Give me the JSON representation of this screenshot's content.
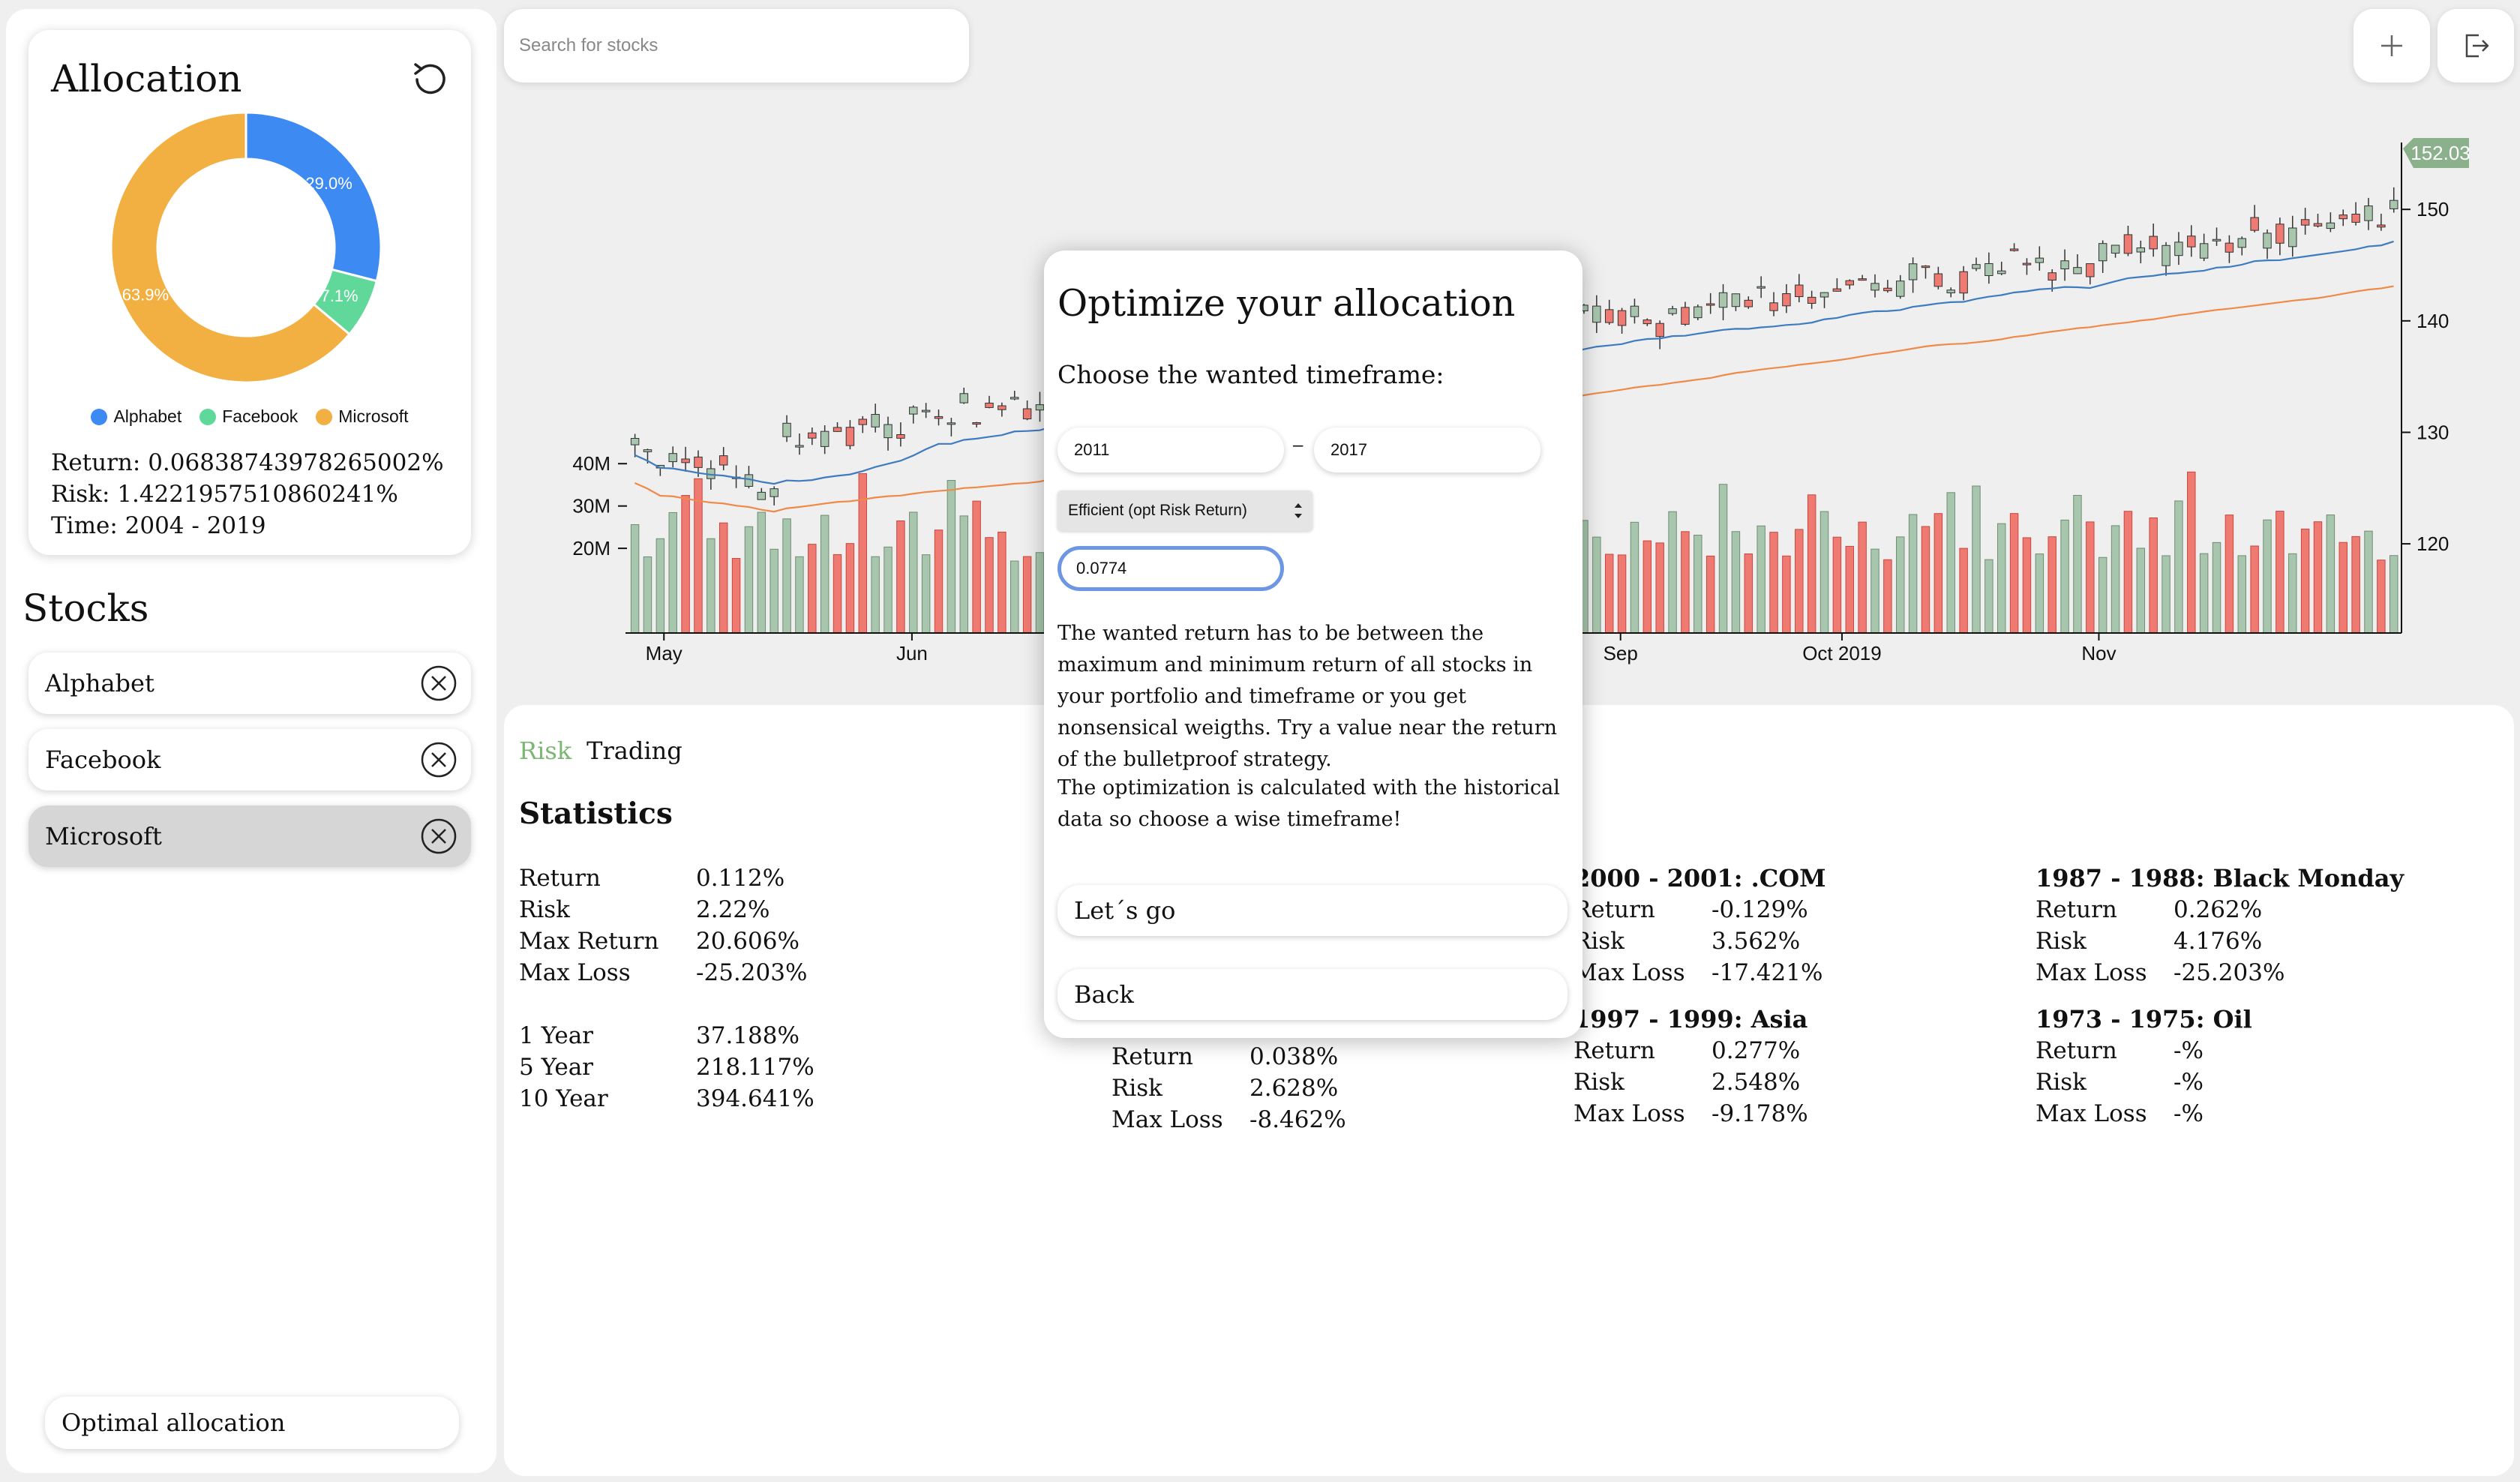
{
  "allocation": {
    "title": "Allocation",
    "return_text": "Return: 0.06838743978265002%",
    "risk_text": "Risk: 1.4221957510860241%",
    "time_text": "Time: 2004 - 2019",
    "slices": [
      {
        "name": "Alphabet",
        "value": 29.0,
        "label": "29.0%",
        "color": "#3d8bf2"
      },
      {
        "name": "Facebook",
        "value": 7.1,
        "label": "7.1%",
        "color": "#5fd89a"
      },
      {
        "name": "Microsoft",
        "value": 63.9,
        "label": "63.9%",
        "color": "#f2b042"
      }
    ]
  },
  "stocks": {
    "title": "Stocks",
    "items": [
      {
        "name": "Alphabet",
        "selected": false
      },
      {
        "name": "Facebook",
        "selected": false
      },
      {
        "name": "Microsoft",
        "selected": true
      }
    ],
    "optimal_label": "Optimal allocation"
  },
  "search": {
    "placeholder": "Search for stocks"
  },
  "icons": {
    "reset": "reset-icon",
    "remove": "close-circle-icon",
    "add": "plus-icon",
    "logout": "logout-icon"
  },
  "chart_data": {
    "type": "candlestick",
    "last_price_label": "152.03",
    "price_ticks": [
      120,
      130,
      140,
      150
    ],
    "volume_ticks": [
      "20M",
      "30M",
      "40M"
    ],
    "x_labels": [
      "May",
      "Jun",
      "Sep",
      "Oct 2019",
      "Nov"
    ],
    "ylim": [
      112,
      156
    ],
    "volume_max": 45000000,
    "colors": {
      "up": "#a8c6ad",
      "down": "#ef7a72",
      "ma_fast": "#3f7bbf",
      "ma_slow": "#ee8a4a",
      "label_bg": "#8bb08c"
    }
  },
  "tabs": {
    "risk": "Risk",
    "trading": "Trading"
  },
  "statistics": {
    "title": "Statistics",
    "main": [
      {
        "k": "Return",
        "v": "0.112%"
      },
      {
        "k": "Risk",
        "v": "2.22%"
      },
      {
        "k": "Max Return",
        "v": "20.606%"
      },
      {
        "k": "Max Loss",
        "v": "-25.203%"
      }
    ],
    "years": [
      {
        "k": "1 Year",
        "v": "37.188%"
      },
      {
        "k": "5 Year",
        "v": "218.117%"
      },
      {
        "k": "10 Year",
        "v": "394.641%"
      }
    ],
    "hidden_block": [
      {
        "k": "Return",
        "v": "0.038%"
      },
      {
        "k": "Risk",
        "v": "2.628%"
      },
      {
        "k": "Max Loss",
        "v": "-8.462%"
      }
    ],
    "periods": [
      {
        "title": "2000 - 2001: .COM",
        "rows": [
          {
            "k": "Return",
            "v": "-0.129%"
          },
          {
            "k": "Risk",
            "v": "3.562%"
          },
          {
            "k": "Max Loss",
            "v": "-17.421%"
          }
        ]
      },
      {
        "title": "1997 - 1999: Asia",
        "rows": [
          {
            "k": "Return",
            "v": "0.277%"
          },
          {
            "k": "Risk",
            "v": "2.548%"
          },
          {
            "k": "Max Loss",
            "v": "-9.178%"
          }
        ]
      },
      {
        "title": "1987 - 1988: Black Monday",
        "rows": [
          {
            "k": "Return",
            "v": "0.262%"
          },
          {
            "k": "Risk",
            "v": "4.176%"
          },
          {
            "k": "Max Loss",
            "v": "-25.203%"
          }
        ]
      },
      {
        "title": "1973 - 1975: Oil",
        "rows": [
          {
            "k": "Return",
            "v": "-%"
          },
          {
            "k": "Risk",
            "v": "-%"
          },
          {
            "k": "Max Loss",
            "v": "-%"
          }
        ]
      }
    ]
  },
  "modal": {
    "title": "Optimize your allocation",
    "subtitle": "Choose the wanted timeframe:",
    "year_from": "2011",
    "year_to": "2017",
    "dash": "–",
    "strategy": "Efficient (opt Risk Return)",
    "return_value": "0.0774",
    "text1": "The wanted return has to be between the maximum and minimum return of all stocks in your portfolio and timeframe or you get nonsensical weigths. Try a value near the return of the bulletproof strategy.",
    "text2": "The optimization is calculated with the historical data so choose a wise timeframe!",
    "go_label": "Let´s go",
    "back_label": "Back"
  }
}
